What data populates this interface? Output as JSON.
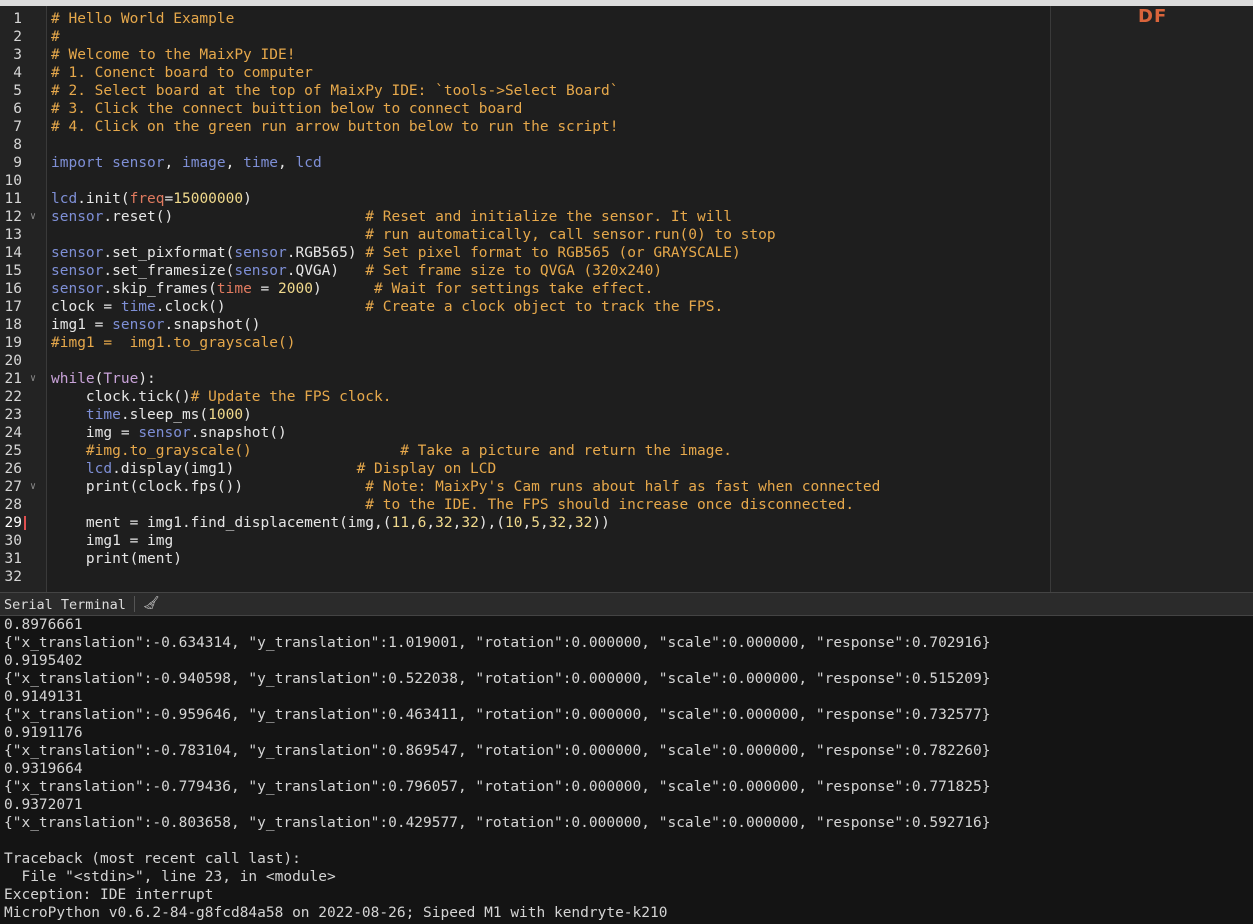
{
  "branding": {
    "logo_text": "DF",
    "logo_color": "#d9643b"
  },
  "editor": {
    "current_line": 29,
    "lines": [
      [
        [
          "c-comment",
          "# Hello World Example"
        ]
      ],
      [
        [
          "c-comment",
          "#"
        ]
      ],
      [
        [
          "c-comment",
          "# Welcome to the MaixPy IDE!"
        ]
      ],
      [
        [
          "c-comment",
          "# 1. Conenct board to computer"
        ]
      ],
      [
        [
          "c-comment",
          "# 2. Select board at the top of MaixPy IDE: `tools->Select Board`"
        ]
      ],
      [
        [
          "c-comment",
          "# 3. Click the connect buittion below to connect board"
        ]
      ],
      [
        [
          "c-comment",
          "# 4. Click on the green run arrow button below to run the script!"
        ]
      ],
      [],
      [
        [
          "c-mod",
          "import"
        ],
        [
          "c-plain",
          " "
        ],
        [
          "c-mod",
          "sensor"
        ],
        [
          "c-plain",
          ", "
        ],
        [
          "c-mod",
          "image"
        ],
        [
          "c-plain",
          ", "
        ],
        [
          "c-mod",
          "time"
        ],
        [
          "c-plain",
          ", "
        ],
        [
          "c-mod",
          "lcd"
        ]
      ],
      [],
      [
        [
          "c-mod",
          "lcd"
        ],
        [
          "c-plain",
          ".init("
        ],
        [
          "c-param",
          "freq"
        ],
        [
          "c-plain",
          "="
        ],
        [
          "c-num",
          "15000000"
        ],
        [
          "c-plain",
          ")"
        ]
      ],
      [
        [
          "c-mod",
          "sensor"
        ],
        [
          "c-plain",
          ".reset()                      "
        ],
        [
          "c-comment",
          "# Reset and initialize the sensor. It will"
        ]
      ],
      [
        [
          "c-plain",
          "                                    "
        ],
        [
          "c-comment",
          "# run automatically, call sensor.run(0) to stop"
        ]
      ],
      [
        [
          "c-mod",
          "sensor"
        ],
        [
          "c-plain",
          ".set_pixformat("
        ],
        [
          "c-mod",
          "sensor"
        ],
        [
          "c-plain",
          ".RGB565) "
        ],
        [
          "c-comment",
          "# Set pixel format to RGB565 (or GRAYSCALE)"
        ]
      ],
      [
        [
          "c-mod",
          "sensor"
        ],
        [
          "c-plain",
          ".set_framesize("
        ],
        [
          "c-mod",
          "sensor"
        ],
        [
          "c-plain",
          ".QVGA)   "
        ],
        [
          "c-comment",
          "# Set frame size to QVGA (320x240)"
        ]
      ],
      [
        [
          "c-mod",
          "sensor"
        ],
        [
          "c-plain",
          ".skip_frames("
        ],
        [
          "c-param",
          "time"
        ],
        [
          "c-plain",
          " = "
        ],
        [
          "c-num",
          "2000"
        ],
        [
          "c-plain",
          ")      "
        ],
        [
          "c-comment",
          "# Wait for settings take effect."
        ]
      ],
      [
        [
          "c-plain",
          "clock = "
        ],
        [
          "c-mod",
          "time"
        ],
        [
          "c-plain",
          ".clock()                "
        ],
        [
          "c-comment",
          "# Create a clock object to track the FPS."
        ]
      ],
      [
        [
          "c-plain",
          "img1 = "
        ],
        [
          "c-mod",
          "sensor"
        ],
        [
          "c-plain",
          ".snapshot()"
        ]
      ],
      [
        [
          "c-comment",
          "#img1 =  img1.to_grayscale()"
        ]
      ],
      [],
      [
        [
          "c-kw",
          "while"
        ],
        [
          "c-plain",
          "("
        ],
        [
          "c-kw",
          "True"
        ],
        [
          "c-plain",
          "):"
        ]
      ],
      [
        [
          "c-plain",
          "    clock.tick()"
        ],
        [
          "c-comment",
          "# Update the FPS clock."
        ]
      ],
      [
        [
          "c-plain",
          "    "
        ],
        [
          "c-mod",
          "time"
        ],
        [
          "c-plain",
          ".sleep_ms("
        ],
        [
          "c-num",
          "1000"
        ],
        [
          "c-plain",
          ")"
        ]
      ],
      [
        [
          "c-plain",
          "    img = "
        ],
        [
          "c-mod",
          "sensor"
        ],
        [
          "c-plain",
          ".snapshot()"
        ]
      ],
      [
        [
          "c-plain",
          "    "
        ],
        [
          "c-comment",
          "#img.to_grayscale()                 # Take a picture and return the image."
        ]
      ],
      [
        [
          "c-plain",
          "    "
        ],
        [
          "c-mod",
          "lcd"
        ],
        [
          "c-plain",
          ".display(img1)              "
        ],
        [
          "c-comment",
          "# Display on LCD"
        ]
      ],
      [
        [
          "c-plain",
          "    print(clock.fps())              "
        ],
        [
          "c-comment",
          "# Note: MaixPy's Cam runs about half as fast when connected"
        ]
      ],
      [
        [
          "c-plain",
          "                                    "
        ],
        [
          "c-comment",
          "# to the IDE. The FPS should increase once disconnected."
        ]
      ],
      [
        [
          "c-plain",
          "    ment = img1.find_displacement(img,("
        ],
        [
          "c-num",
          "11"
        ],
        [
          "c-plain",
          ","
        ],
        [
          "c-num",
          "6"
        ],
        [
          "c-plain",
          ","
        ],
        [
          "c-num",
          "32"
        ],
        [
          "c-plain",
          ","
        ],
        [
          "c-num",
          "32"
        ],
        [
          "c-plain",
          "),("
        ],
        [
          "c-num",
          "10"
        ],
        [
          "c-plain",
          ","
        ],
        [
          "c-num",
          "5"
        ],
        [
          "c-plain",
          ","
        ],
        [
          "c-num",
          "32"
        ],
        [
          "c-plain",
          ","
        ],
        [
          "c-num",
          "32"
        ],
        [
          "c-plain",
          "))"
        ]
      ],
      [
        [
          "c-plain",
          "    img1 = img"
        ]
      ],
      [
        [
          "c-plain",
          "    print(ment)"
        ]
      ],
      []
    ],
    "fold_lines": [
      12,
      21,
      27
    ]
  },
  "terminal": {
    "title": "Serial Terminal",
    "clear_icon": "broom-icon",
    "lines": [
      "0.8976661",
      "{\"x_translation\":-0.634314, \"y_translation\":1.019001, \"rotation\":0.000000, \"scale\":0.000000, \"response\":0.702916}",
      "0.9195402",
      "{\"x_translation\":-0.940598, \"y_translation\":0.522038, \"rotation\":0.000000, \"scale\":0.000000, \"response\":0.515209}",
      "0.9149131",
      "{\"x_translation\":-0.959646, \"y_translation\":0.463411, \"rotation\":0.000000, \"scale\":0.000000, \"response\":0.732577}",
      "0.9191176",
      "{\"x_translation\":-0.783104, \"y_translation\":0.869547, \"rotation\":0.000000, \"scale\":0.000000, \"response\":0.782260}",
      "0.9319664",
      "{\"x_translation\":-0.779436, \"y_translation\":0.796057, \"rotation\":0.000000, \"scale\":0.000000, \"response\":0.771825}",
      "0.9372071",
      "{\"x_translation\":-0.803658, \"y_translation\":0.429577, \"rotation\":0.000000, \"scale\":0.000000, \"response\":0.592716}",
      "",
      "Traceback (most recent call last):",
      "  File \"<stdin>\", line 23, in <module>",
      "Exception: IDE interrupt",
      "MicroPython v0.6.2-84-g8fcd84a58 on 2022-08-26; Sipeed M1 with kendryte-k210"
    ]
  }
}
